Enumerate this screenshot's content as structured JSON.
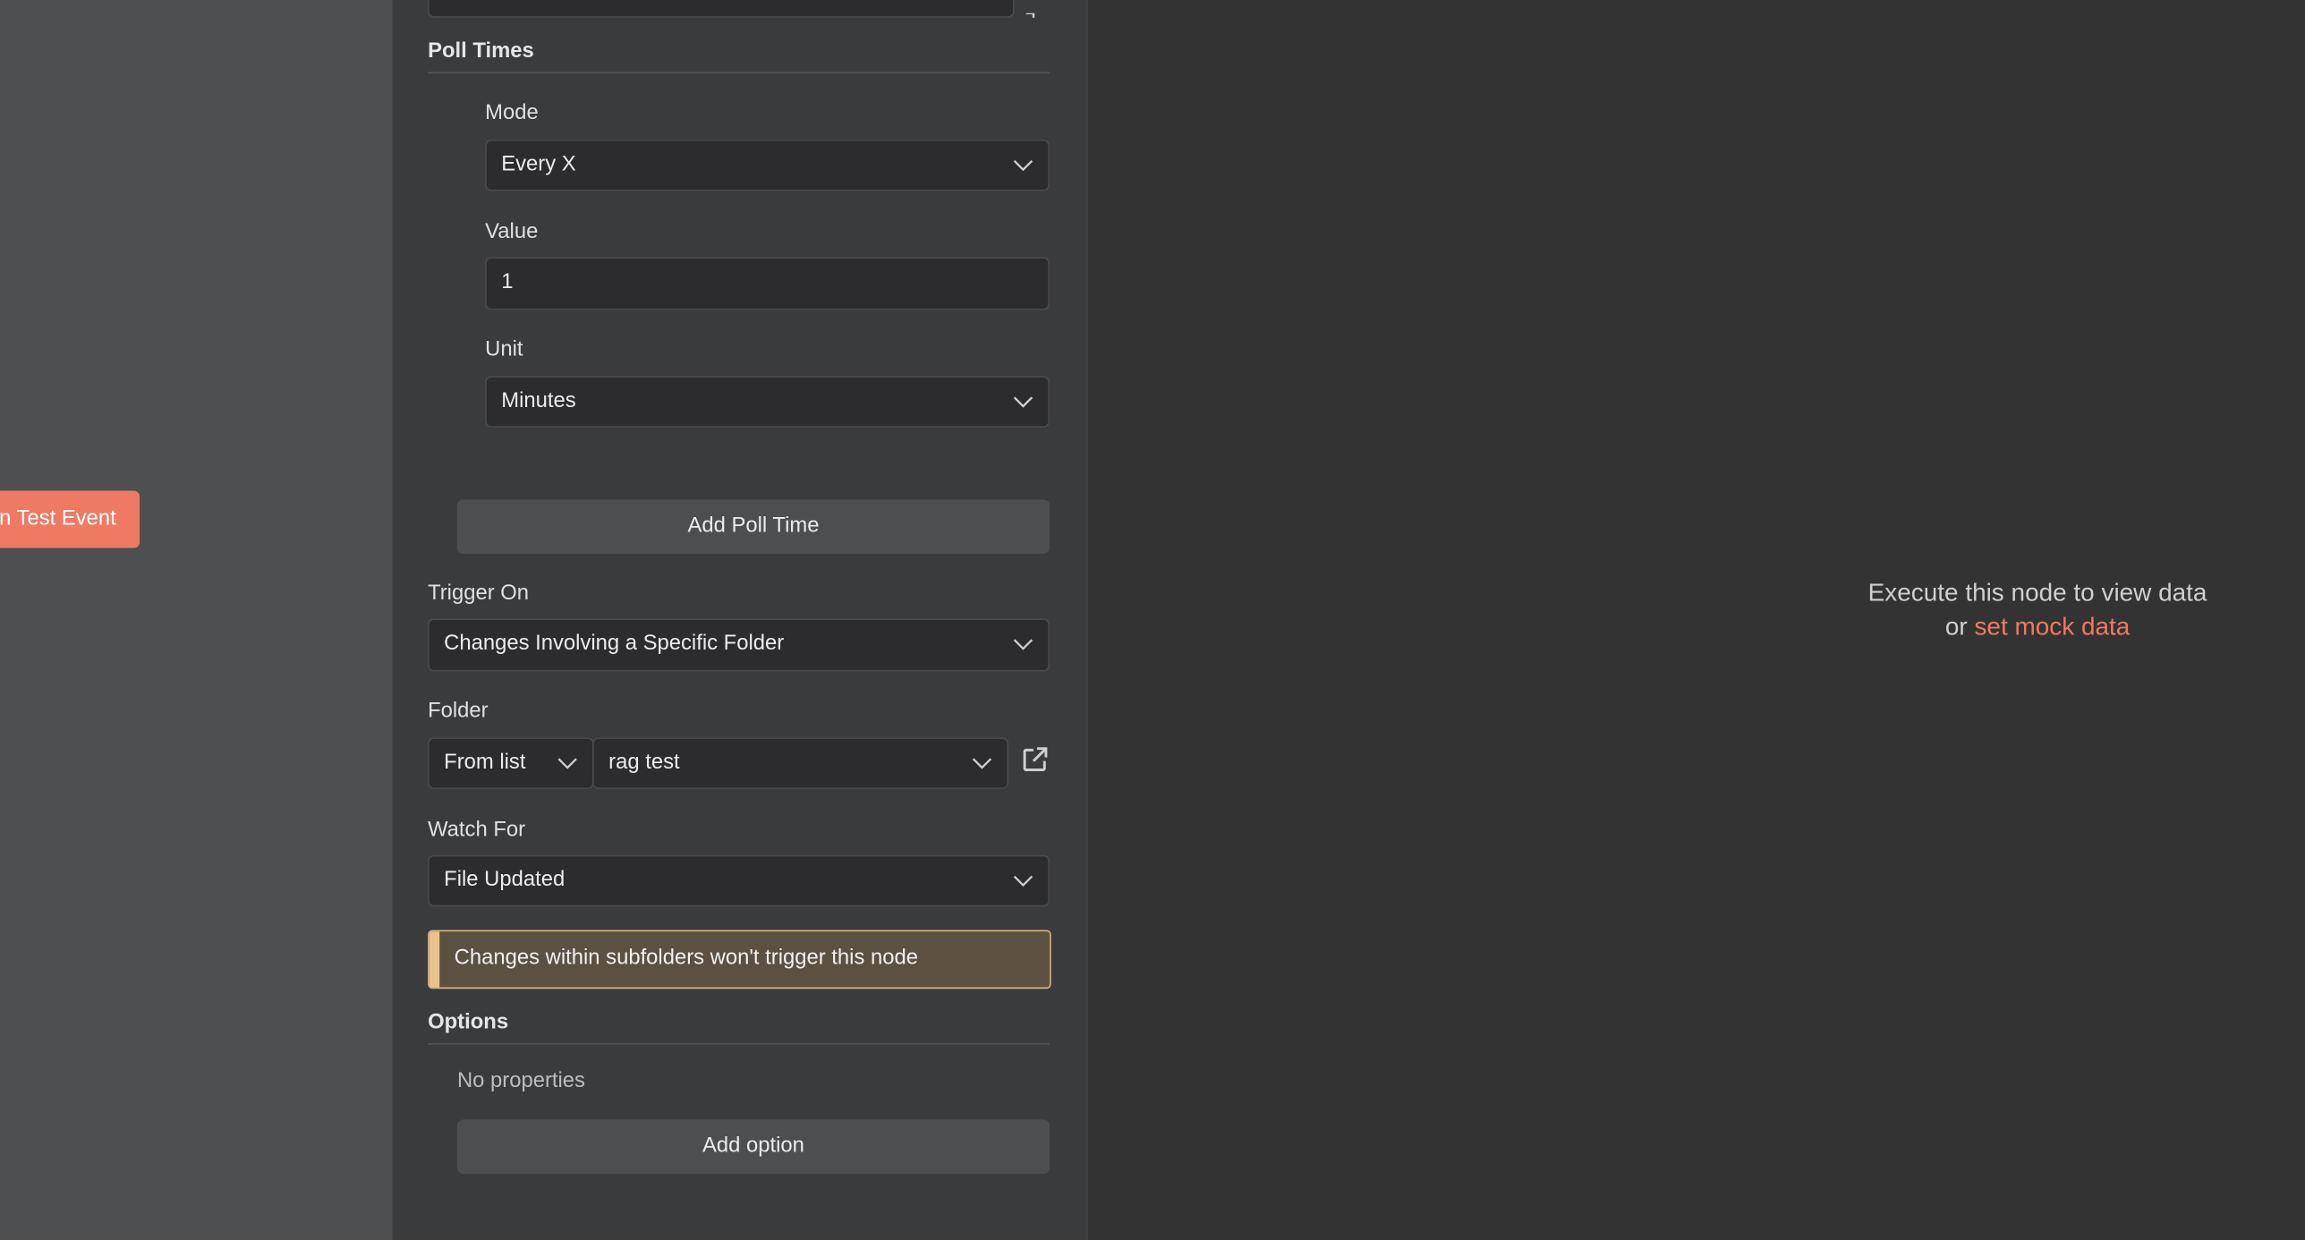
{
  "canvas": {
    "test_button_label": "n Test Event"
  },
  "params": {
    "poll_times": {
      "title": "Poll Times",
      "mode": {
        "label": "Mode",
        "value": "Every X"
      },
      "value": {
        "label": "Value",
        "value": "1"
      },
      "unit": {
        "label": "Unit",
        "value": "Minutes"
      },
      "add_button": "Add Poll Time"
    },
    "trigger_on": {
      "label": "Trigger On",
      "value": "Changes Involving a Specific Folder"
    },
    "folder": {
      "label": "Folder",
      "mode": "From list",
      "value": "rag test"
    },
    "watch_for": {
      "label": "Watch For",
      "value": "File Updated"
    },
    "notice": "Changes within subfolders won't trigger this node",
    "options": {
      "title": "Options",
      "empty": "No properties",
      "add_button": "Add option"
    }
  },
  "output": {
    "message": "Execute this node to view data",
    "or": "or",
    "link": "set mock data"
  },
  "colors": {
    "accent": "#ee7a63",
    "notice_border": "#d9b37a",
    "panel": "#3a3b3d"
  },
  "icons": {
    "chevron": "chevron-down-icon",
    "open_link": "external-link-icon"
  }
}
